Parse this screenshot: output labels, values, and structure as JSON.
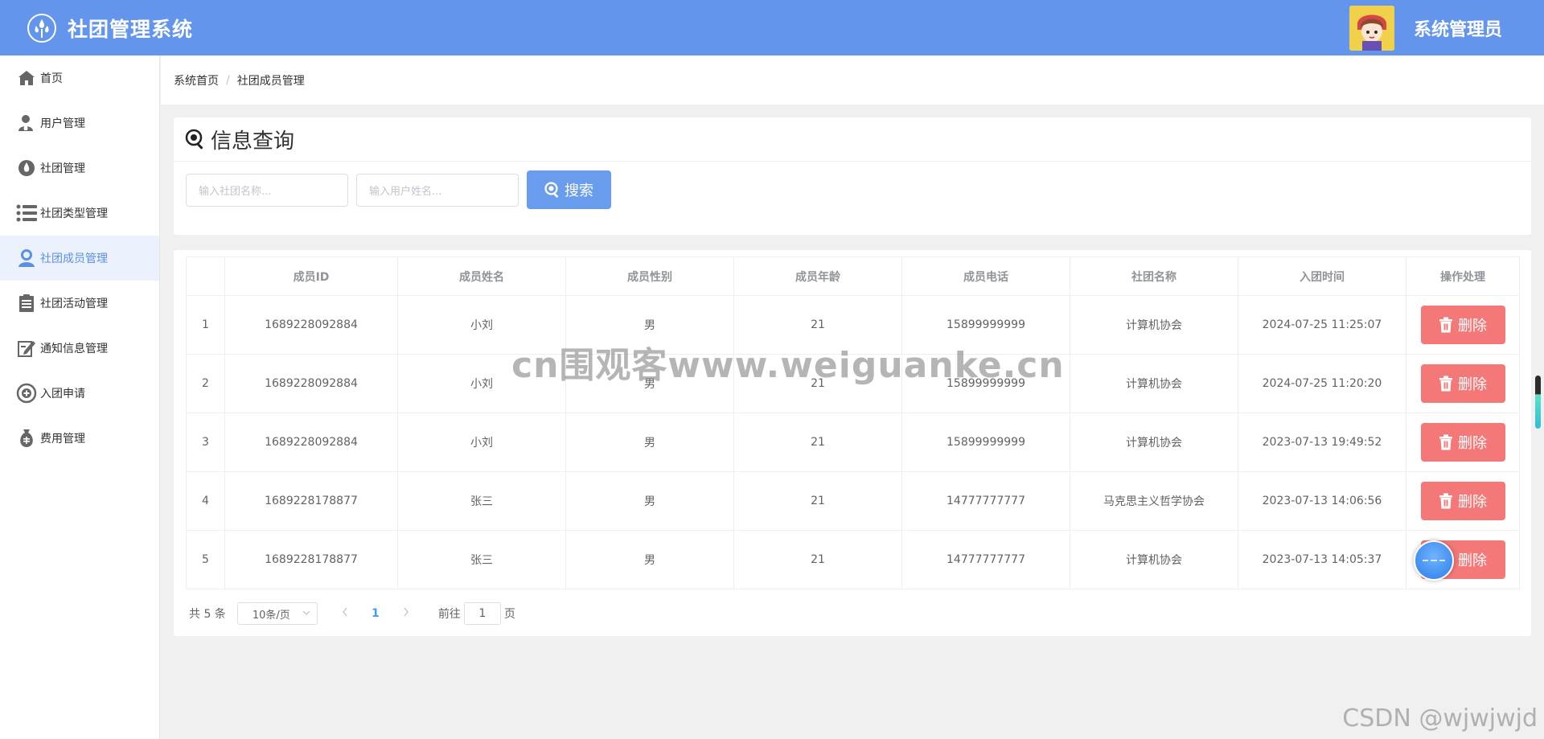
{
  "header": {
    "app_title": "社团管理系统",
    "admin_name": "系统管理员",
    "logo_icon": "drop-cluster-icon",
    "bg_color": "#6495ed"
  },
  "sidebar": {
    "items": [
      {
        "label": "首页",
        "icon": "home-icon"
      },
      {
        "label": "用户管理",
        "icon": "user-add-icon"
      },
      {
        "label": "社团管理",
        "icon": "drop-icon"
      },
      {
        "label": "社团类型管理",
        "icon": "list-icon"
      },
      {
        "label": "社团成员管理",
        "icon": "member-icon",
        "active": true
      },
      {
        "label": "社团活动管理",
        "icon": "document-icon"
      },
      {
        "label": "通知信息管理",
        "icon": "edit-note-icon"
      },
      {
        "label": "入团申请",
        "icon": "add-circle-icon"
      },
      {
        "label": "费用管理",
        "icon": "money-bag-icon"
      }
    ]
  },
  "breadcrumb": {
    "home": "系统首页",
    "separator": "/",
    "current": "社团成员管理"
  },
  "search": {
    "title": "信息查询",
    "club_placeholder": "输入社团名称...",
    "user_placeholder": "输入用户姓名...",
    "button_label": "搜索"
  },
  "table": {
    "columns": [
      "",
      "成员ID",
      "成员姓名",
      "成员性别",
      "成员年龄",
      "成员电话",
      "社团名称",
      "入团时间",
      "操作处理"
    ],
    "rows": [
      {
        "index": "1",
        "id": "1689228092884",
        "name": "小刘",
        "gender": "男",
        "age": "21",
        "phone": "15899999999",
        "club": "计算机协会",
        "time": "2024-07-25 11:25:07",
        "action": "删除"
      },
      {
        "index": "2",
        "id": "1689228092884",
        "name": "小刘",
        "gender": "男",
        "age": "21",
        "phone": "15899999999",
        "club": "计算机协会",
        "time": "2024-07-25 11:20:20",
        "action": "删除"
      },
      {
        "index": "3",
        "id": "1689228092884",
        "name": "小刘",
        "gender": "男",
        "age": "21",
        "phone": "15899999999",
        "club": "计算机协会",
        "time": "2023-07-13 19:49:52",
        "action": "删除"
      },
      {
        "index": "4",
        "id": "1689228178877",
        "name": "张三",
        "gender": "男",
        "age": "21",
        "phone": "14777777777",
        "club": "马克思主义哲学协会",
        "time": "2023-07-13 14:06:56",
        "action": "删除"
      },
      {
        "index": "5",
        "id": "1689228178877",
        "name": "张三",
        "gender": "男",
        "age": "21",
        "phone": "14777777777",
        "club": "计算机协会",
        "time": "2023-07-13 14:05:37",
        "action": "删除"
      }
    ]
  },
  "pagination": {
    "total_text": "共 5 条",
    "page_size": "10条/页",
    "current_page": "1",
    "goto_label": "前往",
    "goto_value": "1",
    "page_suffix": "页"
  },
  "overlays": {
    "watermark": "cn围观客www.weiguanke.cn",
    "csdn_mark": "CSDN @wjwjwjd"
  },
  "colors": {
    "accent": "#6495ed",
    "search_button": "#6a9ced",
    "delete_button": "#f47878",
    "active_page": "#409eff"
  }
}
